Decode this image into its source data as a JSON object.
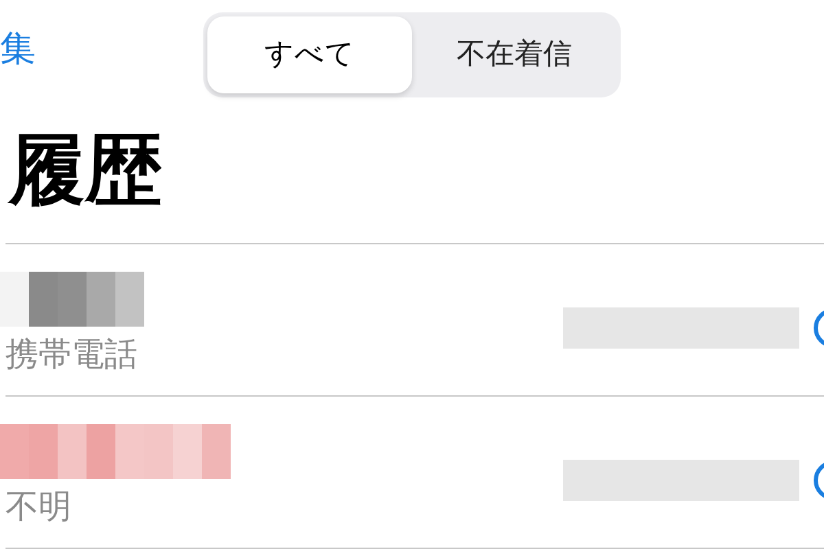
{
  "nav": {
    "edit_button": "集"
  },
  "segments": [
    {
      "label": "すべて",
      "selected": true
    },
    {
      "label": "不在着信",
      "selected": false
    }
  ],
  "title": "履歴",
  "calls": [
    {
      "missed": false,
      "type_label": "携帯電話"
    },
    {
      "missed": true,
      "type_label": "不明"
    }
  ]
}
